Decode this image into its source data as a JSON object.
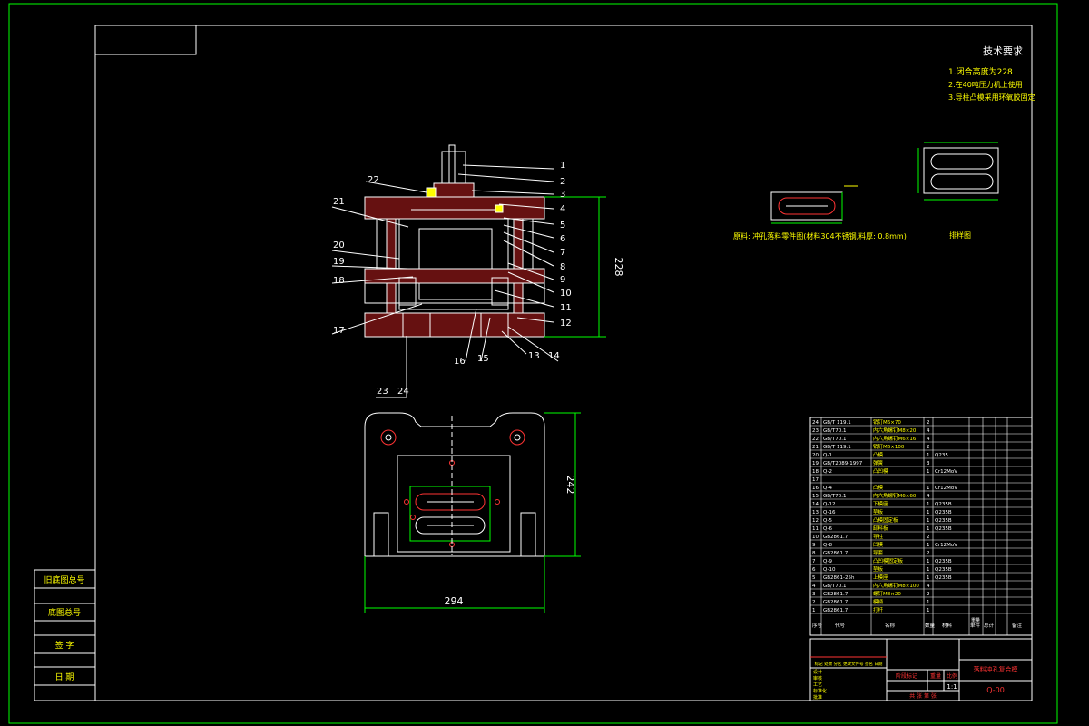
{
  "colors": {
    "background": "#000000",
    "border": "#00ff00",
    "lines": "#ffffff",
    "hatch": "#ff3333",
    "dimension": "#00ff00",
    "yellow": "#ffff00",
    "cyan": "#00ffff",
    "title_red": "#ff3333"
  },
  "tech_requirements": {
    "title": "技术要求",
    "items": [
      "1.闭合高度为228",
      "2.在40吨压力机上使用",
      "3.导柱凸模采用环氧胶固定"
    ]
  },
  "part_note": "原料: 冲孔落料零件图(材料304不锈钢,料厚: 0.8mm)",
  "strip_label": "排样图",
  "dimensions": {
    "height": "228",
    "width_top": "242",
    "width_bottom": "294"
  },
  "callouts_right": [
    "1",
    "2",
    "3",
    "4",
    "5",
    "6",
    "7",
    "8",
    "9",
    "10",
    "11",
    "12",
    "13",
    "14"
  ],
  "callouts_left": [
    "22",
    "21",
    "20",
    "19",
    "18",
    "17"
  ],
  "callouts_bottom": [
    "16",
    "15",
    "23",
    "24"
  ],
  "bom": [
    {
      "no": "24",
      "code": "GB/T 119.1",
      "name": "销钉M6×70",
      "qty": "2",
      "material": ""
    },
    {
      "no": "23",
      "code": "GB/T70.1",
      "name": "内六角螺钉M8×20",
      "qty": "4",
      "material": ""
    },
    {
      "no": "22",
      "code": "GB/T70.1",
      "name": "内六角螺钉M6×16",
      "qty": "4",
      "material": ""
    },
    {
      "no": "21",
      "code": "GB/T 119.1",
      "name": "销钉M6×100",
      "qty": "2",
      "material": ""
    },
    {
      "no": "20",
      "code": "Q-1",
      "name": "凸模",
      "qty": "1",
      "material": "Q235"
    },
    {
      "no": "19",
      "code": "GB/T2089-1997",
      "name": "弹簧",
      "qty": "3",
      "material": ""
    },
    {
      "no": "18",
      "code": "Q-2",
      "name": "凸凹模",
      "qty": "1",
      "material": "Cr12MoV"
    },
    {
      "no": "17",
      "code": "",
      "name": "",
      "qty": "",
      "material": ""
    },
    {
      "no": "16",
      "code": "Q-4",
      "name": "凸模",
      "qty": "1",
      "material": "Cr12MoV"
    },
    {
      "no": "15",
      "code": "GB/T70.1",
      "name": "内六角螺钉M6×60",
      "qty": "4",
      "material": ""
    },
    {
      "no": "14",
      "code": "Q-12",
      "name": "下模座",
      "qty": "1",
      "material": "Q235B"
    },
    {
      "no": "13",
      "code": "Q-16",
      "name": "垫板",
      "qty": "1",
      "material": "Q235B"
    },
    {
      "no": "12",
      "code": "Q-5",
      "name": "凸模固定板",
      "qty": "1",
      "material": "Q235B"
    },
    {
      "no": "11",
      "code": "Q-6",
      "name": "卸料板",
      "qty": "1",
      "material": "Q235B"
    },
    {
      "no": "10",
      "code": "GB2861.7",
      "name": "导柱",
      "qty": "2",
      "material": ""
    },
    {
      "no": "9",
      "code": "Q-8",
      "name": "凹模",
      "qty": "1",
      "material": "Cr12MoV"
    },
    {
      "no": "8",
      "code": "GB2861.7",
      "name": "导套",
      "qty": "2",
      "material": ""
    },
    {
      "no": "7",
      "code": "Q-9",
      "name": "凸凹模固定板",
      "qty": "1",
      "material": "Q235B"
    },
    {
      "no": "6",
      "code": "Q-10",
      "name": "垫板",
      "qty": "1",
      "material": "Q235B"
    },
    {
      "no": "5",
      "code": "GB2861-25h",
      "name": "上模座",
      "qty": "1",
      "material": "Q235B"
    },
    {
      "no": "4",
      "code": "GB/T70.1",
      "name": "内六角螺钉M8×100",
      "qty": "4",
      "material": ""
    },
    {
      "no": "3",
      "code": "GB2861.7",
      "name": "螺钉M8×20",
      "qty": "2",
      "material": ""
    },
    {
      "no": "2",
      "code": "GB2861.7",
      "name": "模柄",
      "qty": "1",
      "material": ""
    },
    {
      "no": "1",
      "code": "GB2861.7",
      "name": "打杆",
      "qty": "1",
      "material": ""
    }
  ],
  "bom_header": {
    "no": "序号",
    "code": "代号",
    "name": "名称",
    "qty": "数量",
    "material": "材料",
    "single": "单件",
    "total": "总计",
    "weight": "重量",
    "remark": "备注"
  },
  "title_block": {
    "drawing_name": "落料冲孔复合模",
    "drawing_code": "Q-00",
    "scale": "1:1",
    "stage_label": "阶段标记",
    "weight_label": "重量",
    "scale_label": "比例",
    "sheet": "共  张  第  张",
    "rows": [
      "设计",
      "审核",
      "工艺",
      "标准化",
      "批准"
    ],
    "mod_labels": "标记 处数 分区 更改文件号 签名 日期"
  },
  "left_stamp": [
    "旧底图总号",
    "底图总号",
    "签 字",
    "日 期"
  ]
}
